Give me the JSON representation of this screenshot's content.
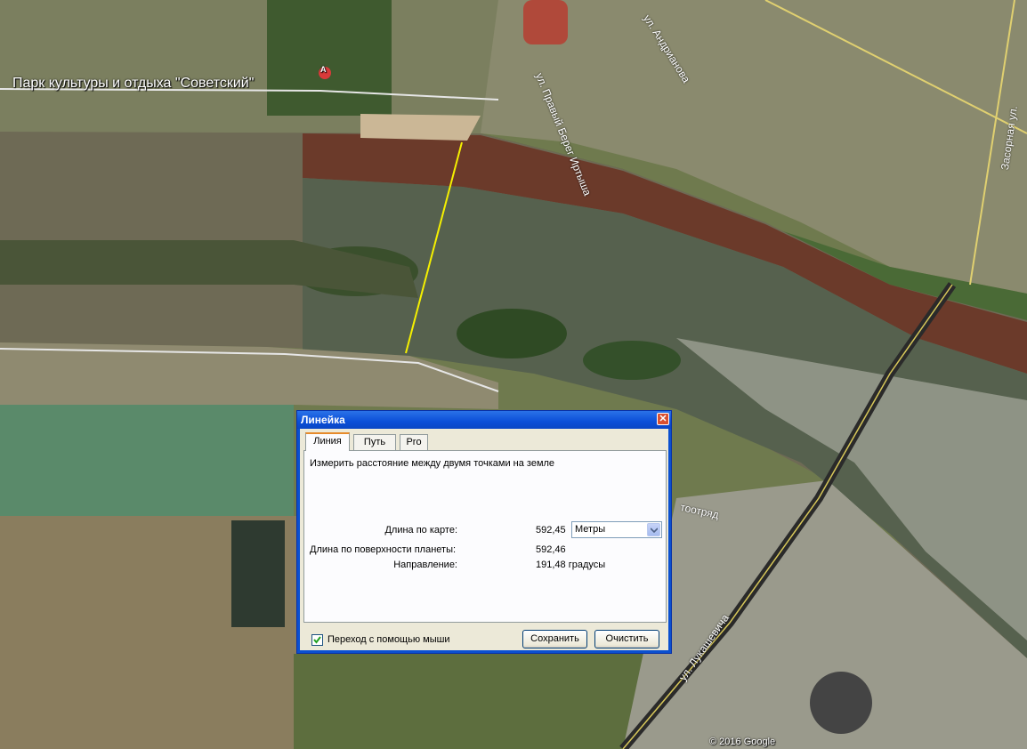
{
  "map": {
    "place_label": "Парк культуры и отдыха \"Советский\"",
    "marker_letter": "A",
    "copyright": "© 2016 Google",
    "streets": {
      "andrianova": "ул. Андрианова",
      "pravyy_bereg": "ул. Правый Берег Иртыша",
      "zasornaya": "Засорная ул.",
      "lukashevicha": "ул. Лукашевича",
      "partial": "тоотряд"
    }
  },
  "dialog": {
    "title": "Линейка",
    "close_glyph": "✕",
    "tabs": [
      "Линия",
      "Путь",
      "Pro"
    ],
    "active_tab": "Линия",
    "instruction": "Измерить расстояние между двумя точками на земле",
    "map_length_label": "Длина по карте:",
    "map_length_value": "592,45",
    "unit_selected": "Метры",
    "surface_length_label": "Длина по поверхности планеты:",
    "surface_length_value": "592,46",
    "heading_label": "Направление:",
    "heading_value": "191,48 градусы",
    "mouse_nav_label": "Переход с помощью мыши",
    "mouse_nav_checked": true,
    "save_label": "Сохранить",
    "clear_label": "Очистить"
  },
  "colors": {
    "ruler_line": "#f5f000",
    "title_bar": "#0b4fd8",
    "dialog_bg": "#ece9d8",
    "tab_highlight": "#e68b2c"
  }
}
